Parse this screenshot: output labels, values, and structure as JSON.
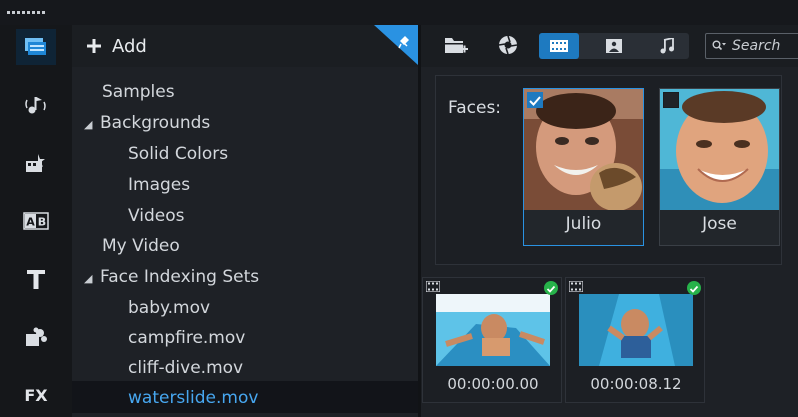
{
  "app": {
    "accent": "#1e7ac0",
    "selected_text": "#47a7f0",
    "check_ok": "#27b24a"
  },
  "rail": {
    "items": [
      {
        "icon": "media-library-icon",
        "active": true
      },
      {
        "icon": "audio-icon"
      },
      {
        "icon": "instant-project-icon"
      },
      {
        "icon": "transition-icon",
        "glyph": "AB"
      },
      {
        "icon": "title-icon",
        "glyph": "T"
      },
      {
        "icon": "graphics-icon"
      },
      {
        "icon": "filter-icon",
        "glyph": "FX"
      }
    ]
  },
  "library": {
    "add_label": "Add",
    "items": [
      {
        "label": "Samples",
        "level": 0,
        "expander": false
      },
      {
        "label": "Backgrounds",
        "level": 0,
        "expander": true
      },
      {
        "label": "Solid Colors",
        "level": 1
      },
      {
        "label": "Images",
        "level": 1
      },
      {
        "label": "Videos",
        "level": 1
      },
      {
        "label": "My Video",
        "level": 0,
        "expander": false
      },
      {
        "label": "Face Indexing Sets",
        "level": 0,
        "expander": true
      },
      {
        "label": "baby.mov",
        "level": 1
      },
      {
        "label": "campfire.mov",
        "level": 1
      },
      {
        "label": "cliff-dive.mov",
        "level": 1
      },
      {
        "label": "waterslide.mov",
        "level": 1,
        "selected": true
      }
    ],
    "expander_glyph": "◢"
  },
  "toolbar": {
    "search_placeholder": "Search",
    "view_modes": [
      "video-view-icon",
      "photo-view-icon",
      "audio-view-icon"
    ],
    "active_view": 0
  },
  "faces": {
    "label": "Faces:",
    "people": [
      {
        "name": "Julio",
        "checked": true,
        "selected": true
      },
      {
        "name": "Jose",
        "checked": false,
        "selected": false
      }
    ]
  },
  "clips": [
    {
      "timecode": "00:00:00.00"
    },
    {
      "timecode": "00:00:08.12"
    }
  ]
}
